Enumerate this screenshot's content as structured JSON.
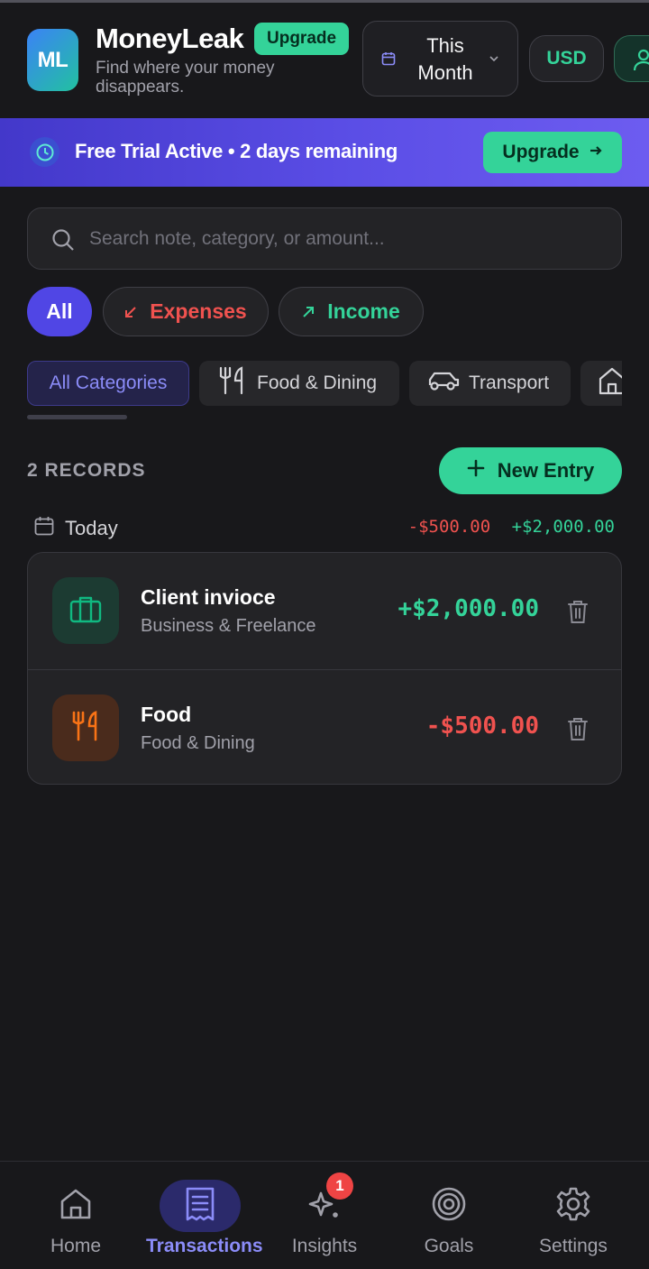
{
  "header": {
    "logo_initials": "ML",
    "app_name": "MoneyLeak",
    "upgrade_badge": "Upgrade",
    "tagline": "Find where your money disappears.",
    "period_label": "This Month",
    "currency": "USD"
  },
  "trial_banner": {
    "text": "Free Trial Active • 2 days remaining",
    "cta": "Upgrade"
  },
  "search": {
    "placeholder": "Search note, category, or amount...",
    "value": ""
  },
  "type_filters": {
    "all": "All",
    "expenses": "Expenses",
    "income": "Income",
    "selected": "All"
  },
  "categories": {
    "all": "All Categories",
    "food": "Food & Dining",
    "transport": "Transport",
    "selected": "All Categories"
  },
  "records": {
    "count_label": "2 RECORDS",
    "new_entry": "New Entry"
  },
  "day_group": {
    "label": "Today",
    "expense_total": "-$500.00",
    "income_total": "+$2,000.00"
  },
  "transactions": [
    {
      "title": "Client invioce",
      "category": "Business & Freelance",
      "amount": "+$2,000.00",
      "type": "income",
      "icon": "briefcase-icon"
    },
    {
      "title": "Food",
      "category": "Food & Dining",
      "amount": "-$500.00",
      "type": "expense",
      "icon": "utensils-icon"
    }
  ],
  "bottom_nav": {
    "items": [
      {
        "label": "Home",
        "icon": "home-icon"
      },
      {
        "label": "Transactions",
        "icon": "receipt-icon"
      },
      {
        "label": "Insights",
        "icon": "sparkles-icon",
        "badge": "1"
      },
      {
        "label": "Goals",
        "icon": "target-icon"
      },
      {
        "label": "Settings",
        "icon": "gear-icon"
      }
    ],
    "active": "Transactions"
  },
  "colors": {
    "accent": "#5046e5",
    "income": "#34d399",
    "expense": "#f0524f",
    "background": "#18181b"
  }
}
